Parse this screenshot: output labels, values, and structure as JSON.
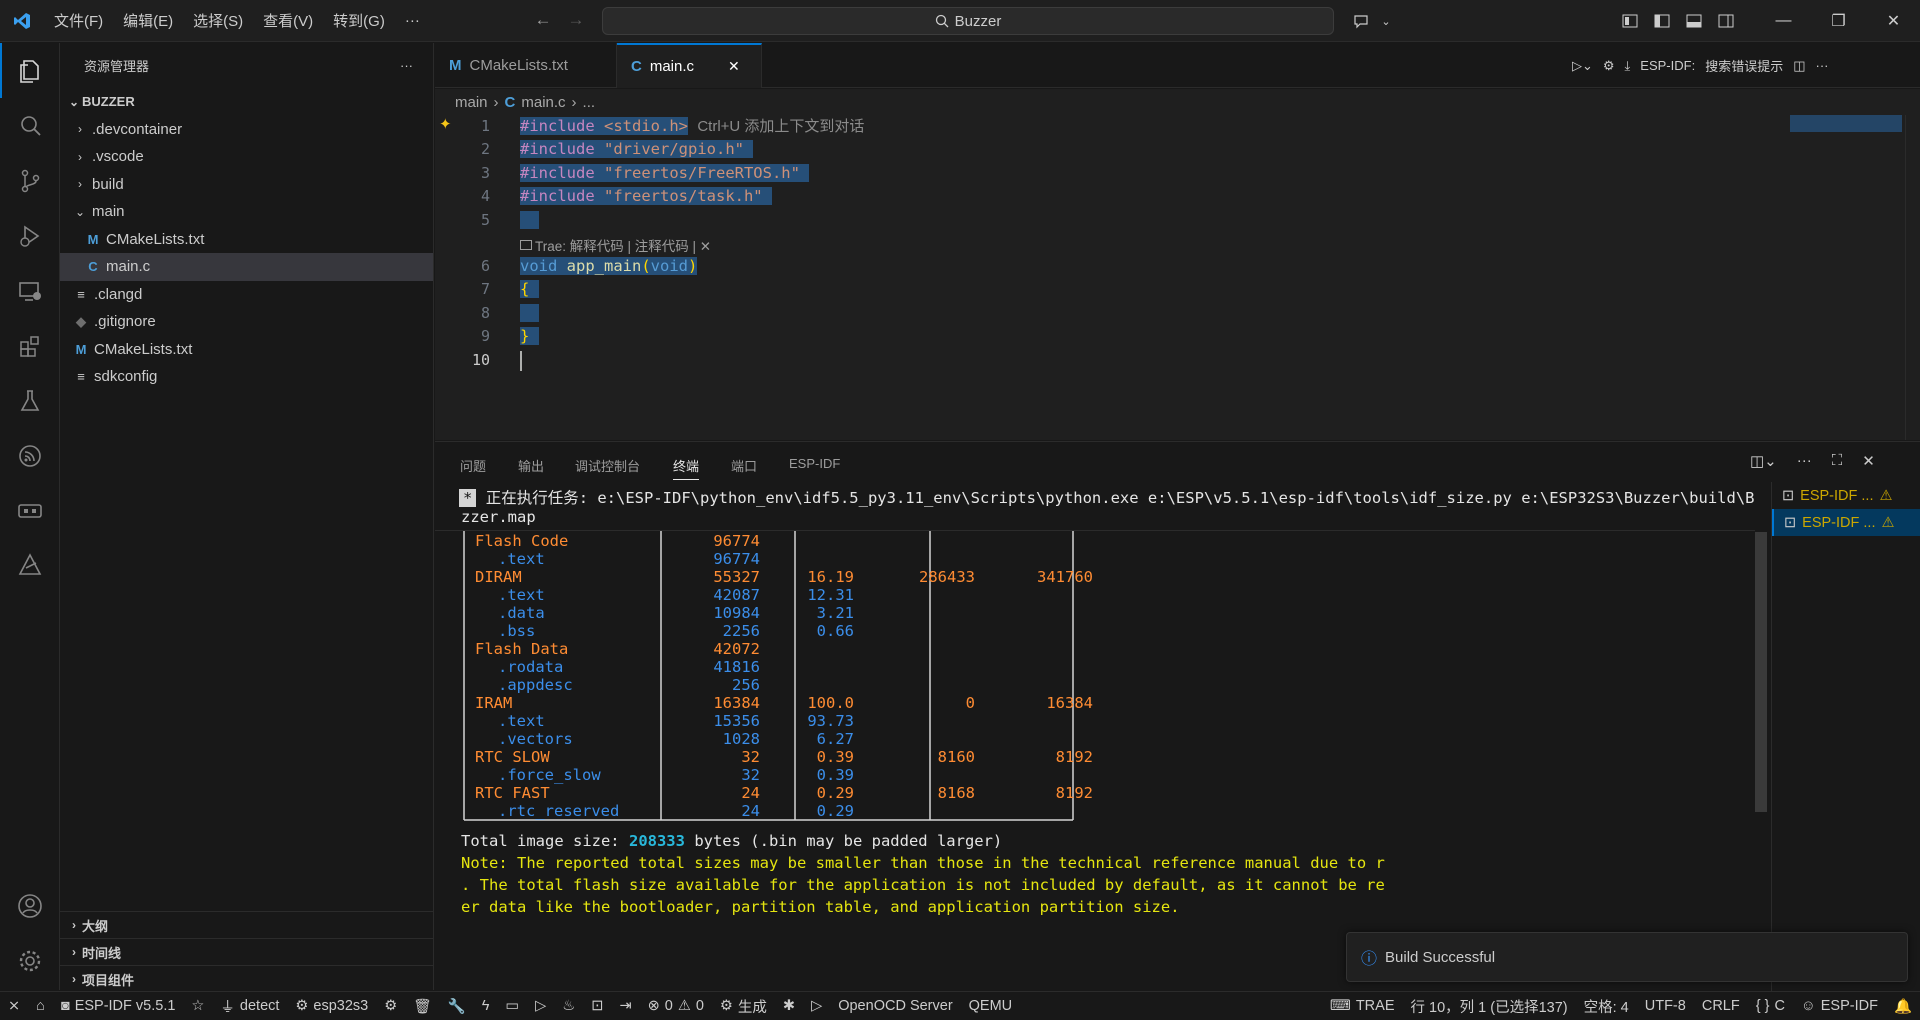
{
  "titlebar": {
    "menus": [
      "文件(F)",
      "编辑(E)",
      "选择(S)",
      "查看(V)",
      "转到(G)",
      "···"
    ],
    "search": "Buzzer"
  },
  "sidebar": {
    "title": "资源管理器",
    "more": "···",
    "root": "BUZZER",
    "items": [
      {
        "label": ".devcontainer",
        "kind": "folder-closed",
        "depth": 1,
        "icon_text": "",
        "icon_color": ""
      },
      {
        "label": ".vscode",
        "kind": "folder-closed",
        "depth": 1,
        "icon_text": "",
        "icon_color": ""
      },
      {
        "label": "build",
        "kind": "folder-closed",
        "depth": 1,
        "icon_text": "",
        "icon_color": ""
      },
      {
        "label": "main",
        "kind": "folder-open",
        "depth": 1,
        "icon_text": "",
        "icon_color": ""
      },
      {
        "label": "CMakeLists.txt",
        "kind": "file",
        "depth": 2,
        "icon_text": "M",
        "icon_color": "#4d9ed8"
      },
      {
        "label": "main.c",
        "kind": "file",
        "depth": 2,
        "icon_text": "C",
        "icon_color": "#4d9ed8",
        "selected": true
      },
      {
        "label": ".clangd",
        "kind": "file",
        "depth": 1,
        "icon_text": "≡",
        "icon_color": "#cccccc"
      },
      {
        "label": ".gitignore",
        "kind": "file",
        "depth": 1,
        "icon_text": "◆",
        "icon_color": "#6e6e6e"
      },
      {
        "label": "CMakeLists.txt",
        "kind": "file",
        "depth": 1,
        "icon_text": "M",
        "icon_color": "#4d9ed8"
      },
      {
        "label": "sdkconfig",
        "kind": "file",
        "depth": 1,
        "icon_text": "≡",
        "icon_color": "#cccccc"
      }
    ],
    "sections": [
      "大纲",
      "时间线",
      "项目组件"
    ]
  },
  "tabs": [
    {
      "label": "CMakeLists.txt",
      "icon": "M"
    },
    {
      "label": "main.c",
      "icon": "C",
      "close": "✕"
    }
  ],
  "editor_toolbar": {
    "espidf_label": "ESP-IDF:",
    "search_hint": "搜索错误提示"
  },
  "breadcrumb": {
    "part1": "main",
    "part2": "main.c",
    "part3": "..."
  },
  "editor": {
    "lines": [
      "1",
      "2",
      "3",
      "4",
      "5",
      "6",
      "7",
      "8",
      "9",
      "10"
    ],
    "l1_kw": "#include",
    "l1_str": "<stdio.h>",
    "l1_hint": "Ctrl+U 添加上下文到对话",
    "l2_kw": "#include",
    "l2_str": "\"driver/gpio.h\"",
    "l3_kw": "#include",
    "l3_str": "\"freertos/FreeRTOS.h\"",
    "l4_kw": "#include",
    "l4_str": "\"freertos/task.h\"",
    "codelens": "Trae: 解释代码 | 注释代码 | ✕",
    "l6_void": "void",
    "l6_fn": "app_main",
    "l6_open": "(",
    "l6_param": "void",
    "l6_close": ")",
    "l7": "{",
    "l9": "}"
  },
  "panel": {
    "tabs": [
      "问题",
      "输出",
      "调试控制台",
      "终端",
      "端口",
      "ESP-IDF"
    ],
    "active_tab": "终端",
    "task_line1": "正在执行任务: e:\\ESP-IDF\\python_env\\idf5.5_py3.11_env\\Scripts\\python.exe e:\\ESP\\v5.5.1\\esp-idf\\tools\\idf_size.py e:\\ESP32S3\\Buzzer\\build\\Bu",
    "task_line2": "zzer.map",
    "task_marker": "*",
    "rows": [
      {
        "name": "Flash Code",
        "level": 0,
        "used": "96774",
        "pct": "",
        "remain": "",
        "total": ""
      },
      {
        "name": ".text",
        "level": 1,
        "used": "96774",
        "pct": "",
        "remain": "",
        "total": ""
      },
      {
        "name": "DIRAM",
        "level": 0,
        "used": "55327",
        "pct": "16.19",
        "remain": "286433",
        "total": "341760"
      },
      {
        "name": ".text",
        "level": 1,
        "used": "42087",
        "pct": "12.31",
        "remain": "",
        "total": ""
      },
      {
        "name": ".data",
        "level": 1,
        "used": "10984",
        "pct": "3.21",
        "remain": "",
        "total": ""
      },
      {
        "name": ".bss",
        "level": 1,
        "used": "2256",
        "pct": "0.66",
        "remain": "",
        "total": ""
      },
      {
        "name": "Flash Data",
        "level": 0,
        "used": "42072",
        "pct": "",
        "remain": "",
        "total": ""
      },
      {
        "name": ".rodata",
        "level": 1,
        "used": "41816",
        "pct": "",
        "remain": "",
        "total": ""
      },
      {
        "name": ".appdesc",
        "level": 1,
        "used": "256",
        "pct": "",
        "remain": "",
        "total": ""
      },
      {
        "name": "IRAM",
        "level": 0,
        "used": "16384",
        "pct": "100.0",
        "remain": "0",
        "total": "16384"
      },
      {
        "name": ".text",
        "level": 1,
        "used": "15356",
        "pct": "93.73",
        "remain": "",
        "total": ""
      },
      {
        "name": ".vectors",
        "level": 1,
        "used": "1028",
        "pct": "6.27",
        "remain": "",
        "total": ""
      },
      {
        "name": "RTC SLOW",
        "level": 0,
        "used": "32",
        "pct": "0.39",
        "remain": "8160",
        "total": "8192"
      },
      {
        "name": ".force_slow",
        "level": 1,
        "used": "32",
        "pct": "0.39",
        "remain": "",
        "total": ""
      },
      {
        "name": "RTC FAST",
        "level": 0,
        "used": "24",
        "pct": "0.29",
        "remain": "8168",
        "total": "8192"
      },
      {
        "name": ".rtc_reserved",
        "level": 1,
        "used": "24",
        "pct": "0.29",
        "remain": "",
        "total": ""
      }
    ],
    "total_prefix": "Total image size: ",
    "total_value": "208333",
    "total_suffix": " bytes (.bin may be padded larger)",
    "note1": "Note: The reported total sizes may be smaller than those in the technical reference manual due to r",
    "note2": ". The total flash size available for the application is not included by default, as it cannot be re",
    "note3": "er data like the bootloader, partition table, and application partition size.",
    "terminals": [
      "ESP-IDF ...",
      "ESP-IDF ..."
    ]
  },
  "toast": {
    "message": "Build Successful"
  },
  "status": {
    "espidf_version": "ESP-IDF v5.5.1",
    "detect": "detect",
    "target": "esp32s3",
    "errors": "0",
    "warnings": "0",
    "build": "生成",
    "openocd": "OpenOCD Server",
    "qemu": "QEMU",
    "trae": "TRAE",
    "position": "行 10，列 1 (已选择137)",
    "spaces": "空格: 4",
    "encoding": "UTF-8",
    "eol": "CRLF",
    "language": "C",
    "espidf": "ESP-IDF"
  },
  "colors": {
    "accent": "#0078d4",
    "selection": "#264f78",
    "terminal_orange": "#ff8c33",
    "terminal_blue": "#3b8eea"
  }
}
